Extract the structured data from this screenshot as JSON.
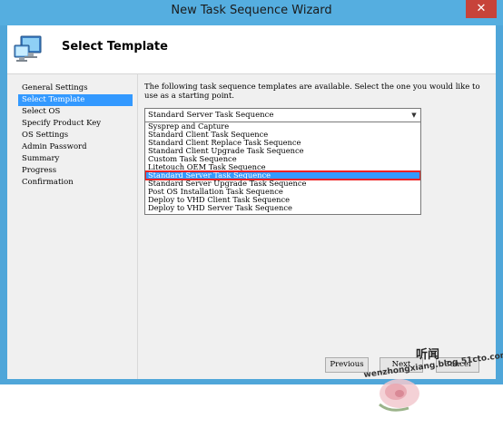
{
  "window": {
    "title": "New Task Sequence Wizard",
    "close_label": "✕",
    "accent_color": "#55aee0"
  },
  "header": {
    "title": "Select Template",
    "icon": "computer-monitor-icon"
  },
  "nav": {
    "items": [
      {
        "label": "General Settings",
        "active": false
      },
      {
        "label": "Select Template",
        "active": true
      },
      {
        "label": "Select OS",
        "active": false
      },
      {
        "label": "Specify Product Key",
        "active": false
      },
      {
        "label": "OS Settings",
        "active": false
      },
      {
        "label": "Admin Password",
        "active": false
      },
      {
        "label": "Summary",
        "active": false
      },
      {
        "label": "Progress",
        "active": false
      },
      {
        "label": "Confirmation",
        "active": false
      }
    ]
  },
  "main": {
    "description": "The following task sequence templates are available.  Select the one you would like to use as a starting point.",
    "combo_value": "Standard Server Task Sequence",
    "options": [
      "Sysprep and Capture",
      "Standard Client Task Sequence",
      "Standard Client Replace Task Sequence",
      "Standard Client Upgrade Task Sequence",
      "Custom Task Sequence",
      "Litetouch OEM Task Sequence",
      "Standard Server Task Sequence",
      "Standard Server Upgrade Task Sequence",
      "Post OS Installation Task Sequence",
      "Deploy to VHD Client Task Sequence",
      "Deploy to VHD Server Task Sequence"
    ],
    "selected_index": 6
  },
  "buttons": {
    "previous": "Previous",
    "next": "Next",
    "cancel": "Cancel"
  },
  "watermark": {
    "cn_text": "听闻",
    "url_text": "wenzhongxiang.blog.51cto.com"
  }
}
